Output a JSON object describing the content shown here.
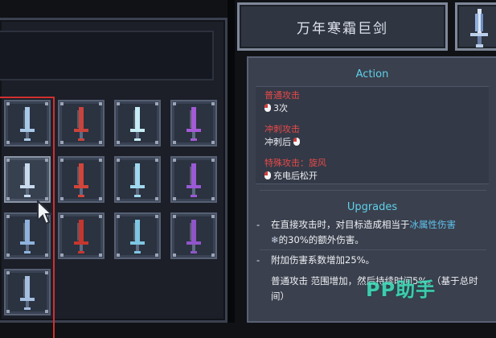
{
  "weapon": {
    "name": "万年寒霜巨剑"
  },
  "action": {
    "header": "Action",
    "attacks": [
      {
        "name": "普通攻击",
        "input": "3次",
        "input_icon": "left-mouse-icon",
        "icon_position": "before"
      },
      {
        "name": "冲刺攻击",
        "input": "冲刺后",
        "input_icon": "left-mouse-icon",
        "icon_position": "after"
      },
      {
        "name": "特殊攻击：旋风",
        "input": "充电后松开",
        "input_icon": "left-mouse-icon",
        "icon_position": "before"
      }
    ]
  },
  "upgrades": {
    "header": "Upgrades",
    "items": [
      {
        "prefix": "在直接攻击时，对目标造成相当于",
        "highlight": "冰属性伤害",
        "suffix_icon": "snowflake-icon",
        "suffix": "的30%的额外伤害。"
      },
      {
        "text": "附加伤害系数增加25%。"
      },
      {
        "text": "普通攻击 范围增加，然后持续时间5%。（基于总时间）"
      }
    ]
  },
  "inventory": {
    "slots": [
      {
        "item": "ice-sword",
        "color": "#a8c8e8"
      },
      {
        "item": "flame-blade",
        "color": "#c8443c"
      },
      {
        "item": "light-saber",
        "color": "#c6ecf4"
      },
      {
        "item": "violet-blade",
        "color": "#a35bd6"
      },
      {
        "item": "frost-greatsword",
        "color": "#c9daef",
        "hovered": true
      },
      {
        "item": "fire-serrated-blade",
        "color": "#d2453a"
      },
      {
        "item": "crystal-sword",
        "color": "#9fd8ee"
      },
      {
        "item": "amethyst-blade",
        "color": "#9a5ad6"
      },
      {
        "item": "frost-arrow-blade",
        "color": "#8fb2dc"
      },
      {
        "item": "flame-sword",
        "color": "#c5362e"
      },
      {
        "item": "runic-blade",
        "color": "#7ec6e2"
      },
      {
        "item": "spiked-violet-blade",
        "color": "#8f55c8"
      },
      {
        "item": "jagged-ice-blade",
        "color": "#a4bee0"
      }
    ]
  },
  "watermark": "PP助手",
  "colors": {
    "accent_cyan": "#5fd0ea",
    "attack_red": "#e84a4a",
    "selection_red": "#d22f2f",
    "ice_blue": "#5fc2ee"
  }
}
